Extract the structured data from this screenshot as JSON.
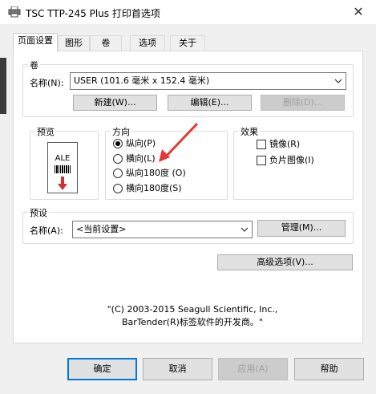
{
  "window": {
    "title": "TSC TTP-245 Plus 打印首选项",
    "close_glyph": "✕"
  },
  "tabs": [
    {
      "label": "页面设置",
      "active": true
    },
    {
      "label": "图形",
      "active": false
    },
    {
      "label": "卷",
      "active": false
    },
    {
      "label": "选项",
      "active": false
    },
    {
      "label": "关于",
      "active": false
    }
  ],
  "roll": {
    "legend": "卷",
    "name_label": "名称(N):",
    "name_value": "USER (101.6 毫米 x 152.4 毫米)",
    "new_button": "新建(W)...",
    "edit_button": "编辑(E)...",
    "delete_button": "删除(D)..."
  },
  "preview": {
    "legend": "预览",
    "label_text": "ALE"
  },
  "orientation": {
    "legend": "方向",
    "options": [
      {
        "label": "纵向(P)",
        "checked": true
      },
      {
        "label": "横向(L)",
        "checked": false
      },
      {
        "label": "纵向180度 (O)",
        "checked": false
      },
      {
        "label": "横向180度(S)",
        "checked": false
      }
    ]
  },
  "effects": {
    "legend": "效果",
    "options": [
      {
        "label": "镜像(R)",
        "checked": false
      },
      {
        "label": "负片图像(I)",
        "checked": false
      }
    ]
  },
  "preset": {
    "legend": "预设",
    "name_label": "名称(A):",
    "name_value": "<当前设置>",
    "manage_button": "管理(M)..."
  },
  "advanced_button": "高级选项(V)...",
  "copyright": {
    "line1": "\"(C) 2003-2015 Seagull Scientific, Inc.,",
    "line2": "BarTender(R)标签软件的开发商。\""
  },
  "footer": {
    "ok": "确定",
    "cancel": "取消",
    "apply": "应用(A)",
    "help": "帮助"
  },
  "colors": {
    "accent": "#0078d7",
    "annotation_arrow": "#e53935"
  }
}
